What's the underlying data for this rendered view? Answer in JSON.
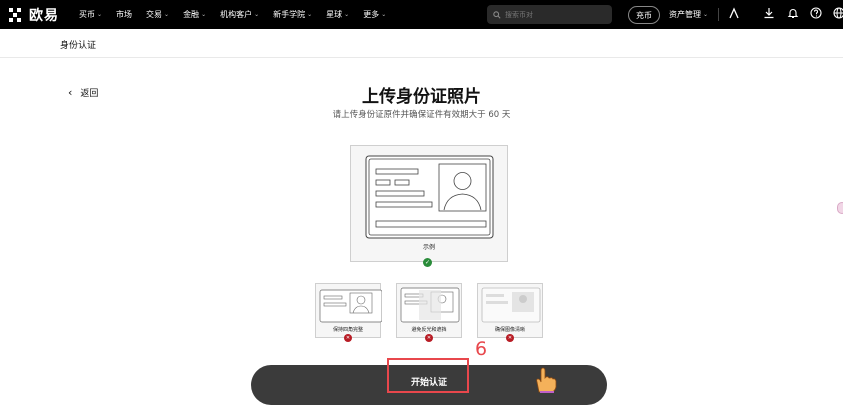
{
  "nav": {
    "logo_text": "欧易",
    "items": [
      {
        "label": "买币",
        "has_caret": true
      },
      {
        "label": "市场",
        "has_caret": false
      },
      {
        "label": "交易",
        "has_caret": true
      },
      {
        "label": "金融",
        "has_caret": true
      },
      {
        "label": "机构客户",
        "has_caret": true
      },
      {
        "label": "新手学院",
        "has_caret": true
      },
      {
        "label": "星球",
        "has_caret": true
      },
      {
        "label": "更多",
        "has_caret": true
      }
    ],
    "search_placeholder": "搜索币对",
    "deposit_label": "充币",
    "assets_label": "资产管理",
    "caret": "⌄"
  },
  "subheader": {
    "title": "身份认证"
  },
  "back_label": "返回",
  "main": {
    "title": "上传身份证照片",
    "subtitle": "请上传身份证原件并确保证件有效期大于 60 天",
    "example_label": "示例",
    "bad_examples": [
      {
        "label": "保持四角完整"
      },
      {
        "label": "避免反光和遮挡"
      },
      {
        "label": "确保图像清晰"
      }
    ],
    "start_button": "开始认证"
  },
  "annotation": {
    "step_number": "6",
    "color": "#e8474c"
  },
  "colors": {
    "accent_ok": "#2a8c3a",
    "accent_bad": "#b81c25",
    "button_bg": "#3b3b3b"
  }
}
